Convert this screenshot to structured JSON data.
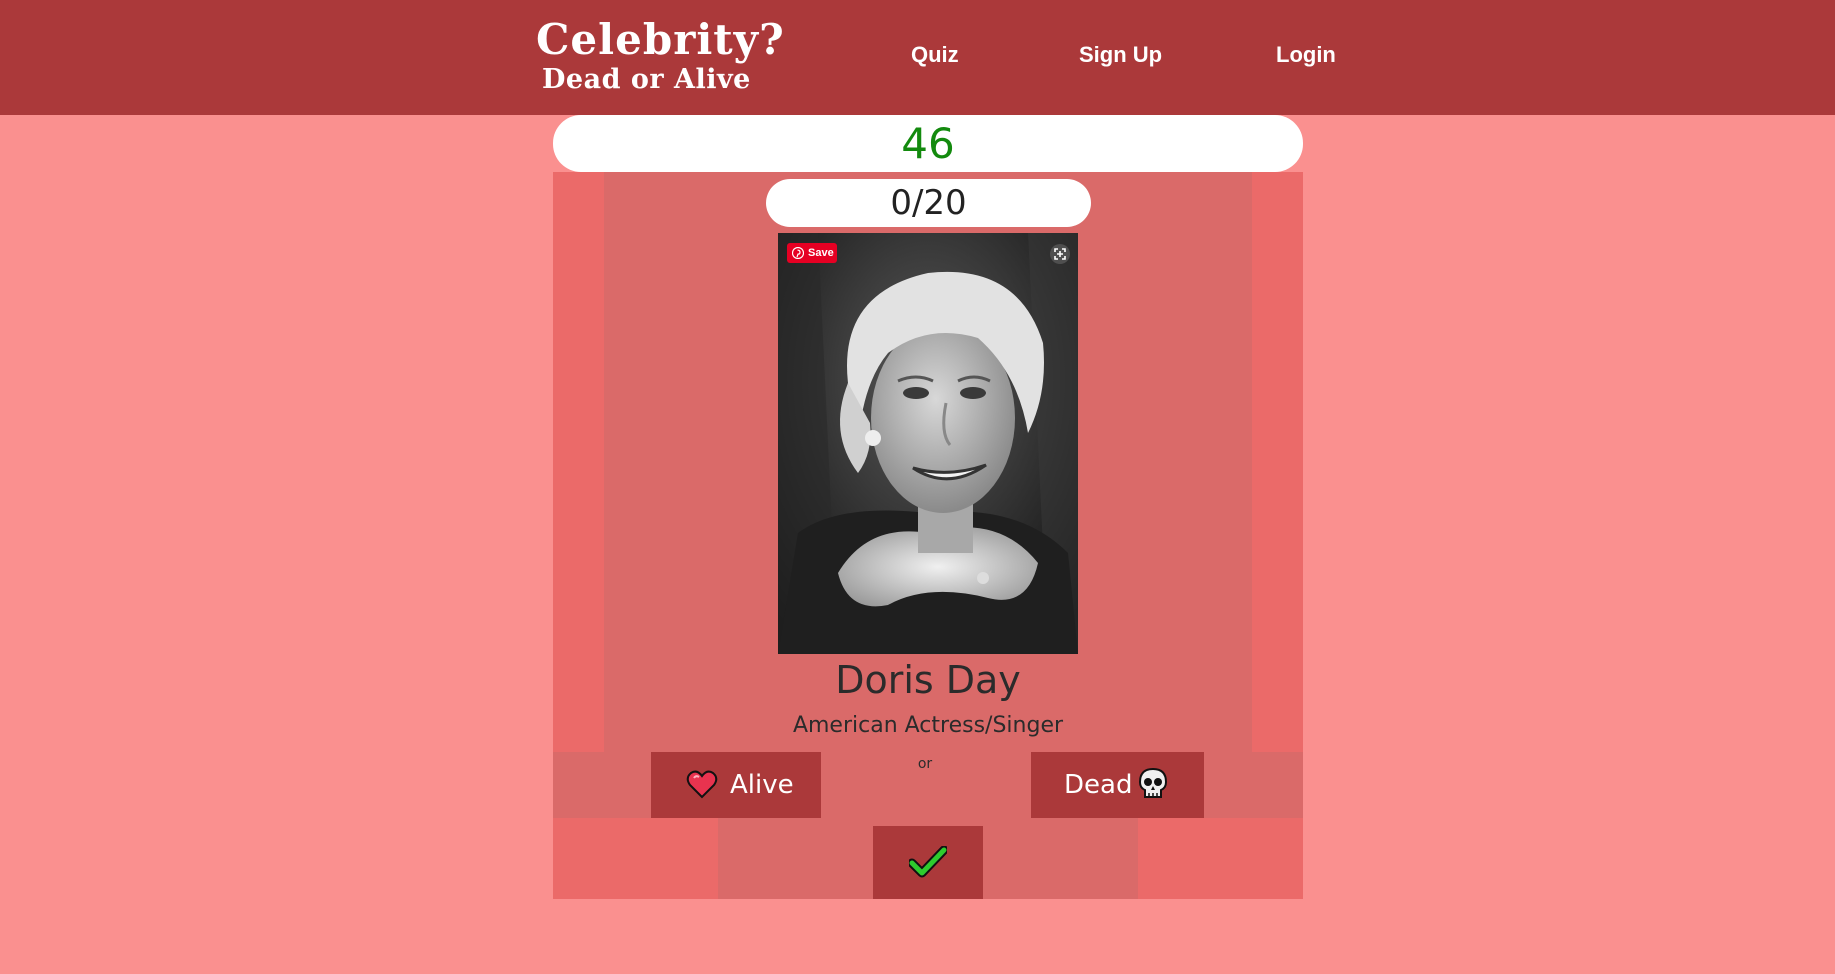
{
  "brand": {
    "line1": "Celebrity?",
    "line2": "Dead or Alive"
  },
  "nav": {
    "items": [
      {
        "label": "Quiz"
      },
      {
        "label": "Sign Up"
      },
      {
        "label": "Login"
      }
    ]
  },
  "game": {
    "score": "46",
    "progress": "0/20",
    "celebrity_name": "Doris Day",
    "celebrity_description": "American Actress/Singer",
    "alive_label": "Alive",
    "dead_label": "Dead",
    "or_label": "or",
    "save_label": "Save"
  },
  "icons": {
    "alive": "heart-icon",
    "dead": "skull-icon",
    "submit": "checkmark-icon",
    "expand": "expand-icon",
    "save": "pinterest-icon"
  },
  "colors": {
    "navbar": "#ab393a",
    "page_background": "#fa908f",
    "score_text": "#138a0e",
    "checkmark": "#2ecc2e"
  }
}
